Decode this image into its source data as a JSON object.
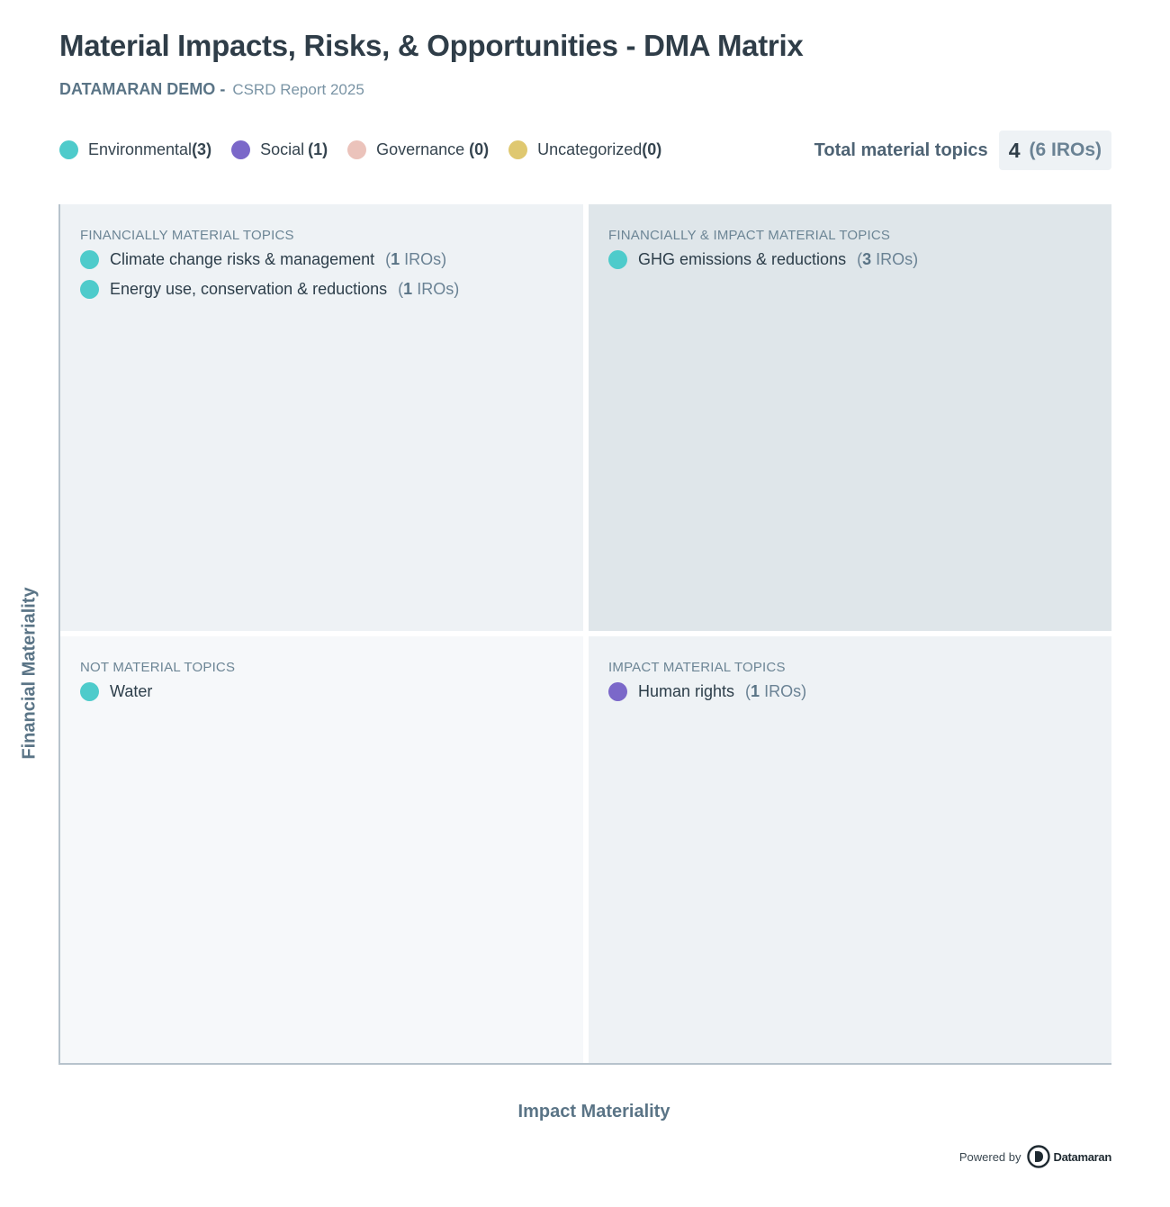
{
  "header": {
    "title": "Material Impacts, Risks, & Opportunities - DMA Matrix",
    "org": "DATAMARAN DEMO -",
    "report": "CSRD Report 2025"
  },
  "legend": {
    "items": [
      {
        "label": "Environmental",
        "count": "(3)",
        "color": "#4ecbcb"
      },
      {
        "label": "Social",
        "count": "(1)",
        "color": "#7b68c9"
      },
      {
        "label": "Governance",
        "count": "(0)",
        "color": "#ebc3bb"
      },
      {
        "label": "Uncategorized",
        "count": "(0)",
        "color": "#dfc870"
      }
    ]
  },
  "total": {
    "label": "Total material topics",
    "value": "4",
    "iros": "(6 IROs)"
  },
  "axes": {
    "y": "Financial Materiality",
    "x": "Impact Materiality"
  },
  "quadrants": {
    "top_left": {
      "title": "FINANCIALLY MATERIAL TOPICS",
      "topics": [
        {
          "name": "Climate change risks & management",
          "iro_count": "1",
          "iro_unit": "IROs)",
          "color": "#4ecbcb"
        },
        {
          "name": "Energy use, conservation & reductions",
          "iro_count": "1",
          "iro_unit": "IROs)",
          "color": "#4ecbcb"
        }
      ]
    },
    "top_right": {
      "title": "FINANCIALLY & IMPACT MATERIAL TOPICS",
      "topics": [
        {
          "name": "GHG emissions & reductions",
          "iro_count": "3",
          "iro_unit": "IROs)",
          "color": "#4ecbcb"
        }
      ]
    },
    "bottom_left": {
      "title": "NOT MATERIAL TOPICS",
      "topics": [
        {
          "name": "Water",
          "color": "#4ecbcb"
        }
      ]
    },
    "bottom_right": {
      "title": "IMPACT MATERIAL TOPICS",
      "topics": [
        {
          "name": "Human rights",
          "iro_count": "1",
          "iro_unit": "IROs)",
          "color": "#7b68c9"
        }
      ]
    }
  },
  "footer": {
    "powered_by": "Powered by",
    "brand": "Datamaran",
    "logo_icon": "datamaran-logo-icon"
  }
}
